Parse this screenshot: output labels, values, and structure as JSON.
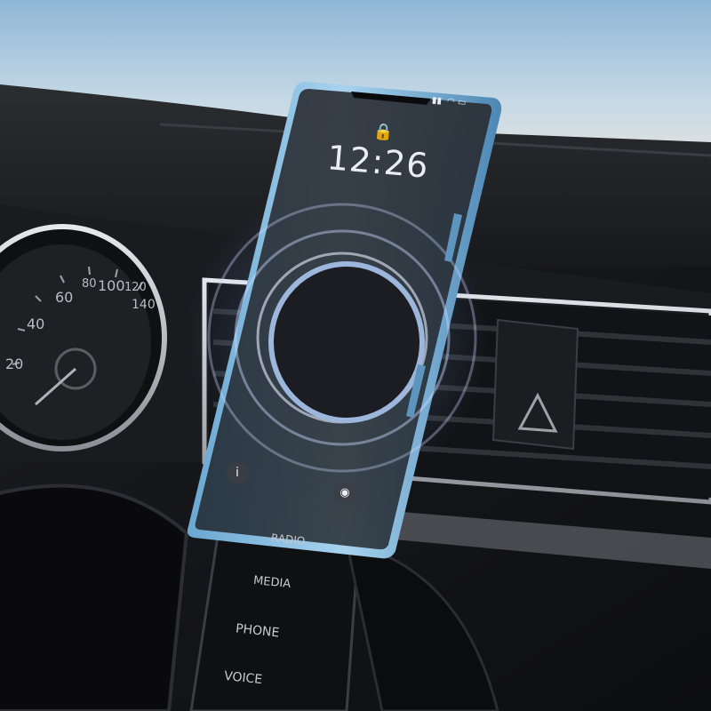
{
  "phone": {
    "clock": "12:26",
    "accent": "#8ec3e6"
  },
  "speedometer": {
    "ticks": [
      "20",
      "40",
      "60",
      "80",
      "100",
      "120",
      "140"
    ]
  },
  "console_buttons": [
    "RADIO",
    "MEDIA",
    "PHONE",
    "VOICE"
  ],
  "icons": [
    "lock-icon",
    "flashlight-icon",
    "camera-icon",
    "hazard-icon",
    "wifi-icon",
    "battery-icon",
    "signal-icon"
  ]
}
